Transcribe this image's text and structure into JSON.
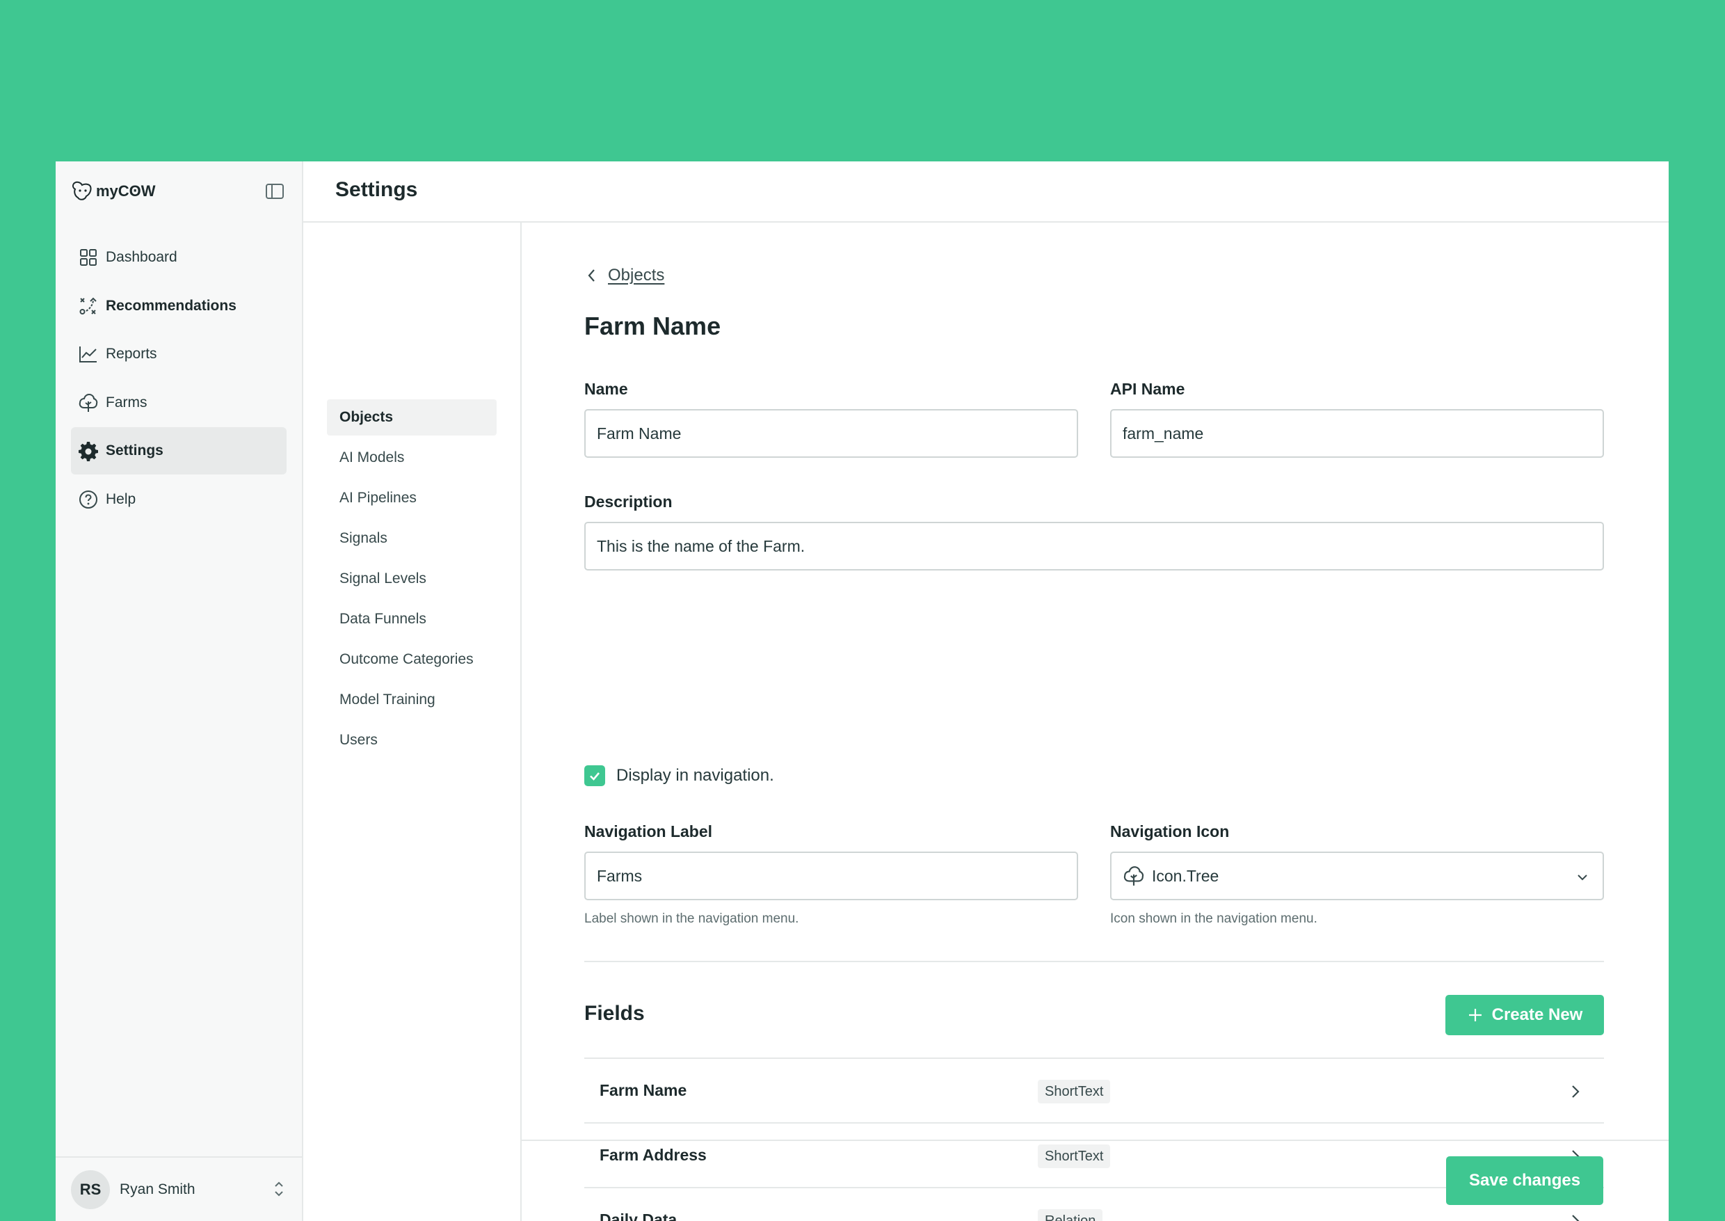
{
  "app": {
    "logo_text": "myCʘW",
    "colors": {
      "accent": "#3fc791",
      "background": "#3fc791",
      "text": "#1d2a2c"
    }
  },
  "sidebar": {
    "items": [
      {
        "label": "Dashboard",
        "icon": "grid-icon"
      },
      {
        "label": "Recommendations",
        "icon": "strategy-icon"
      },
      {
        "label": "Reports",
        "icon": "line-chart-icon"
      },
      {
        "label": "Farms",
        "icon": "tree-icon"
      },
      {
        "label": "Settings",
        "icon": "gear-icon",
        "active": true
      },
      {
        "label": "Help",
        "icon": "help-circle-icon"
      }
    ],
    "user": {
      "initials": "RS",
      "name": "Ryan Smith"
    }
  },
  "header": {
    "title": "Settings"
  },
  "subnav": {
    "items": [
      {
        "label": "Objects",
        "active": true
      },
      {
        "label": "AI Models"
      },
      {
        "label": "AI Pipelines"
      },
      {
        "label": "Signals"
      },
      {
        "label": "Signal Levels"
      },
      {
        "label": "Data Funnels"
      },
      {
        "label": "Outcome Categories"
      },
      {
        "label": "Model Training"
      },
      {
        "label": "Users"
      }
    ]
  },
  "content": {
    "back_label": "Objects",
    "title": "Farm Name",
    "name": {
      "label": "Name",
      "value": "Farm Name"
    },
    "api_name": {
      "label": "API Name",
      "value": "farm_name"
    },
    "description": {
      "label": "Description",
      "value": "This is the name of the Farm."
    },
    "display_in_nav": {
      "label": "Display in navigation.",
      "checked": true
    },
    "nav_label": {
      "label": "Navigation Label",
      "value": "Farms",
      "helper": "Label shown in the navigation menu."
    },
    "nav_icon": {
      "label": "Navigation Icon",
      "value": "Icon.Tree",
      "icon": "tree-icon",
      "helper": "Icon shown in the navigation menu."
    },
    "fields": {
      "title": "Fields",
      "create_label": "Create New",
      "rows": [
        {
          "name": "Farm Name",
          "type": "ShortText"
        },
        {
          "name": "Farm Address",
          "type": "ShortText"
        },
        {
          "name": "Daily Data",
          "type": "Relation"
        }
      ]
    },
    "save_label": "Save changes"
  }
}
